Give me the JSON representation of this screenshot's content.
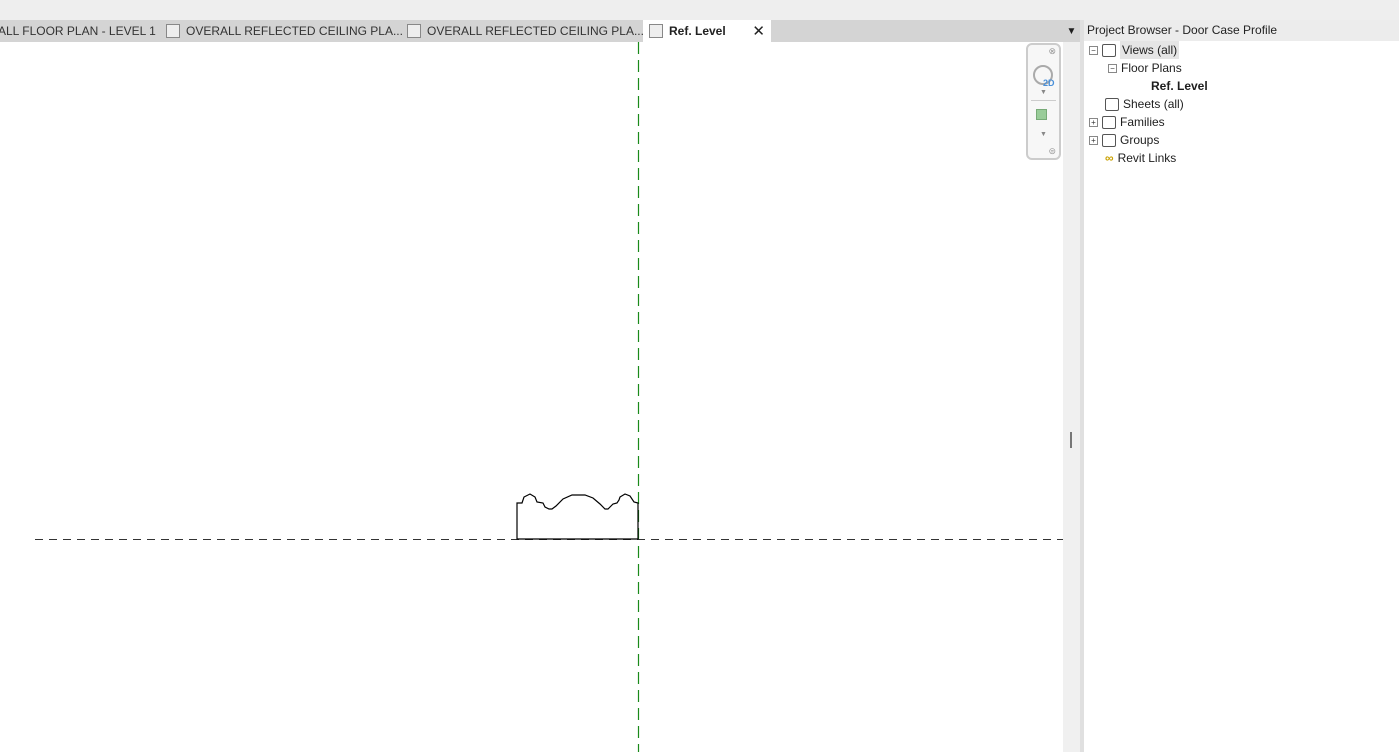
{
  "tabs": [
    {
      "label": "ALL FLOOR PLAN - LEVEL 1",
      "active": false
    },
    {
      "label": "OVERALL REFLECTED CEILING PLA...",
      "active": false
    },
    {
      "label": "OVERALL REFLECTED CEILING PLA...",
      "active": false
    },
    {
      "label": "Ref. Level",
      "active": true,
      "close": "✕"
    }
  ],
  "navigation_bar": {
    "wheel_label": "2D"
  },
  "project_browser": {
    "title": "Project Browser - Door Case Profile",
    "items": [
      {
        "label": "Views (all)",
        "expanded": true,
        "selected": true
      },
      {
        "label": "Floor Plans",
        "expanded": true
      },
      {
        "label": "Ref. Level",
        "bold": true
      },
      {
        "label": "Sheets (all)"
      },
      {
        "label": "Families",
        "expanded": false
      },
      {
        "label": "Groups",
        "expanded": false
      },
      {
        "label": "Revit Links"
      }
    ]
  },
  "colors": {
    "reference_plane": "#1a8a1a",
    "level_line": "#333333",
    "profile": "#000000"
  }
}
